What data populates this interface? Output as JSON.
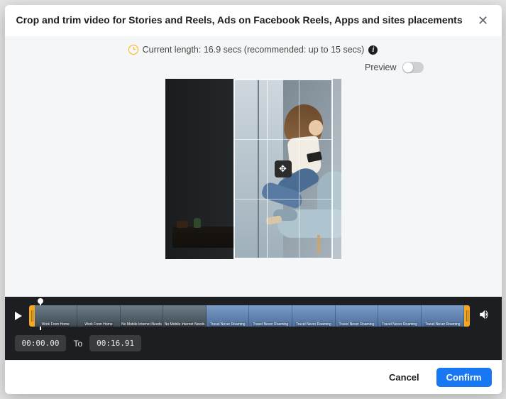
{
  "header": {
    "title": "Crop and trim video for Stories and Reels, Ads on Facebook Reels, Apps and sites placements"
  },
  "status": {
    "length_text": "Current length: 16.9 secs (recommended: up to 15 secs)"
  },
  "preview": {
    "label": "Preview",
    "on": false
  },
  "crop": {
    "move_icon": "move-icon"
  },
  "timeline": {
    "start": "00:00.00",
    "to_label": "To",
    "end": "00:16.91",
    "frame_labels": [
      "Work From Home",
      "Work From Home",
      "No Mobile Internet Needs",
      "No Mobile Internet Needs",
      "Travel Never Roaming",
      "Travel Never Roaming",
      "Travel Never Roaming",
      "Travel Never Roaming",
      "Travel Never Roaming",
      "Travel Never Roaming"
    ]
  },
  "footer": {
    "cancel": "Cancel",
    "confirm": "Confirm"
  }
}
